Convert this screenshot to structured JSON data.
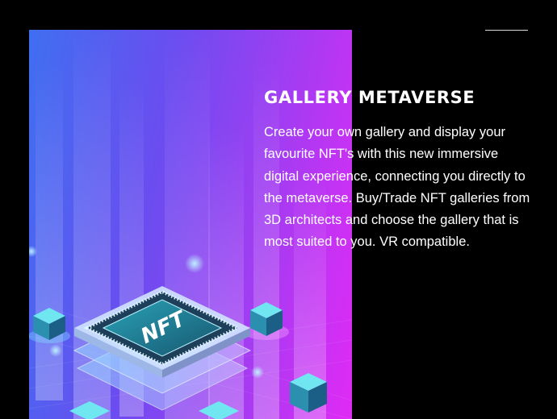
{
  "feature": {
    "title": "GALLERY METAVERSE",
    "description": "Create your own gallery and display your favourite NFT's with this new immersive digital experience, connecting you directly to the metaverse. Buy/Trade NFT galleries from 3D architects and choose the gallery that is most suited to you. VR compatible."
  },
  "illustration": {
    "chip_label": "NFT",
    "icon": "nft-chip-illustration",
    "colors": {
      "gradient_start": "#3f6ff0",
      "gradient_end": "#e02af5",
      "chip_face": "#1f8fa8",
      "cube_top": "#6fe6f0"
    }
  },
  "colors": {
    "background": "#000000",
    "text": "#ffffff"
  }
}
